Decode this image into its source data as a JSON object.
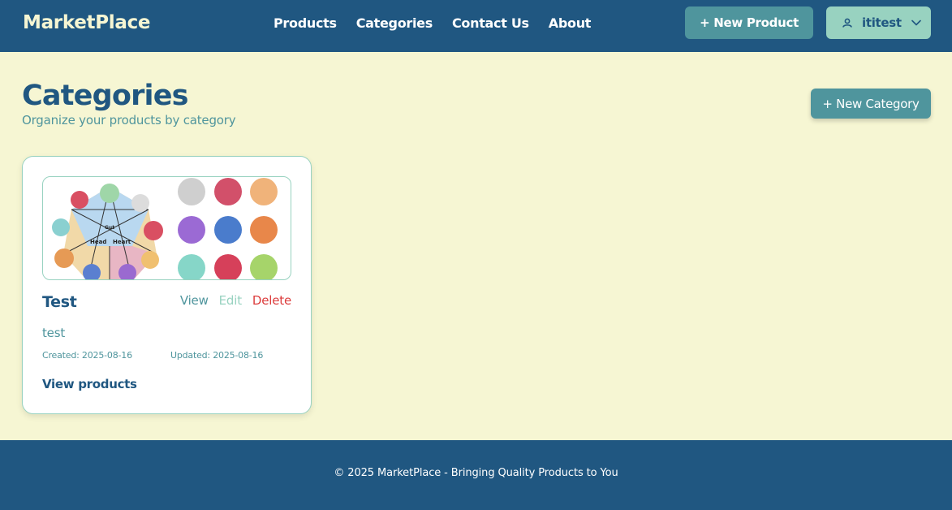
{
  "header": {
    "brand": "MarketPlace",
    "nav": [
      "Products",
      "Categories",
      "Contact Us",
      "About"
    ],
    "new_product_label": "+ New Product",
    "username": "ititest"
  },
  "main": {
    "title": "Categories",
    "subtitle": "Organize your products by category",
    "new_category_label": "+ New Category",
    "categories": [
      {
        "name": "Test",
        "description": "test",
        "created": "Created: 2025-08-16",
        "updated": "Updated: 2025-08-16",
        "actions": {
          "view": "View",
          "edit": "Edit",
          "delete": "Delete"
        },
        "view_products_label": "View products",
        "image_labels": [
          "Gut",
          "Head",
          "Heart"
        ]
      }
    ]
  },
  "footer": {
    "text": "© 2025 MarketPlace - Bringing Quality Products to You"
  },
  "colors": {
    "primary": "#205781",
    "secondary": "#4f959d",
    "accent": "#98d2c0",
    "background": "#f6f6d3",
    "danger": "#dc3c3c"
  },
  "icons": {
    "user": "user-icon",
    "dropdown": "chevron-down-icon"
  }
}
